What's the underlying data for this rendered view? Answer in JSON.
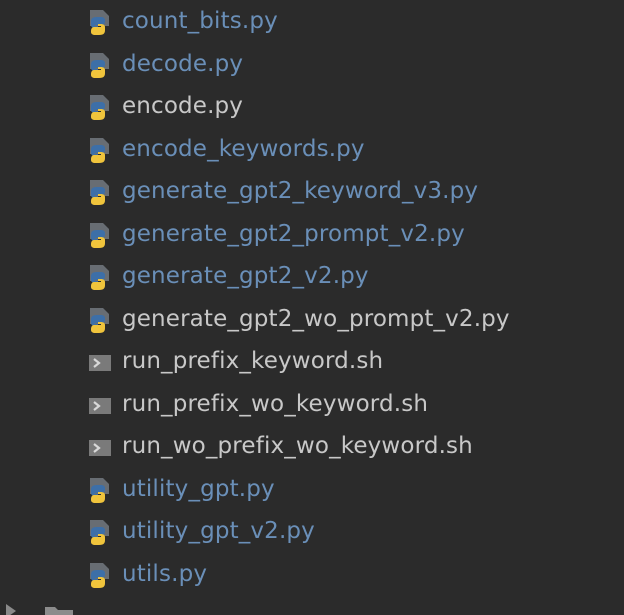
{
  "files": [
    {
      "name": "count_bits.py",
      "type": "python",
      "status": "modified"
    },
    {
      "name": "decode.py",
      "type": "python",
      "status": "modified"
    },
    {
      "name": "encode.py",
      "type": "python",
      "status": "normal"
    },
    {
      "name": "encode_keywords.py",
      "type": "python",
      "status": "modified"
    },
    {
      "name": "generate_gpt2_keyword_v3.py",
      "type": "python",
      "status": "modified"
    },
    {
      "name": "generate_gpt2_prompt_v2.py",
      "type": "python",
      "status": "modified"
    },
    {
      "name": "generate_gpt2_v2.py",
      "type": "python",
      "status": "modified"
    },
    {
      "name": "generate_gpt2_wo_prompt_v2.py",
      "type": "python",
      "status": "normal"
    },
    {
      "name": "run_prefix_keyword.sh",
      "type": "shell",
      "status": "normal"
    },
    {
      "name": "run_prefix_wo_keyword.sh",
      "type": "shell",
      "status": "normal"
    },
    {
      "name": "run_wo_prefix_wo_keyword.sh",
      "type": "shell",
      "status": "normal"
    },
    {
      "name": "utility_gpt.py",
      "type": "python",
      "status": "modified"
    },
    {
      "name": "utility_gpt_v2.py",
      "type": "python",
      "status": "modified"
    },
    {
      "name": "utils.py",
      "type": "python",
      "status": "modified"
    }
  ],
  "colors": {
    "background": "#2b2b2b",
    "modified_text": "#6a8fb8",
    "normal_text": "#c8c8c8",
    "python_blue": "#3d6fa8",
    "python_yellow": "#f0c43c",
    "shell_icon": "#7a7a7a"
  },
  "icons": {
    "python": "python-file-icon",
    "shell": "shell-script-icon",
    "folder": "folder-icon",
    "expand": "chevron-right-icon"
  }
}
